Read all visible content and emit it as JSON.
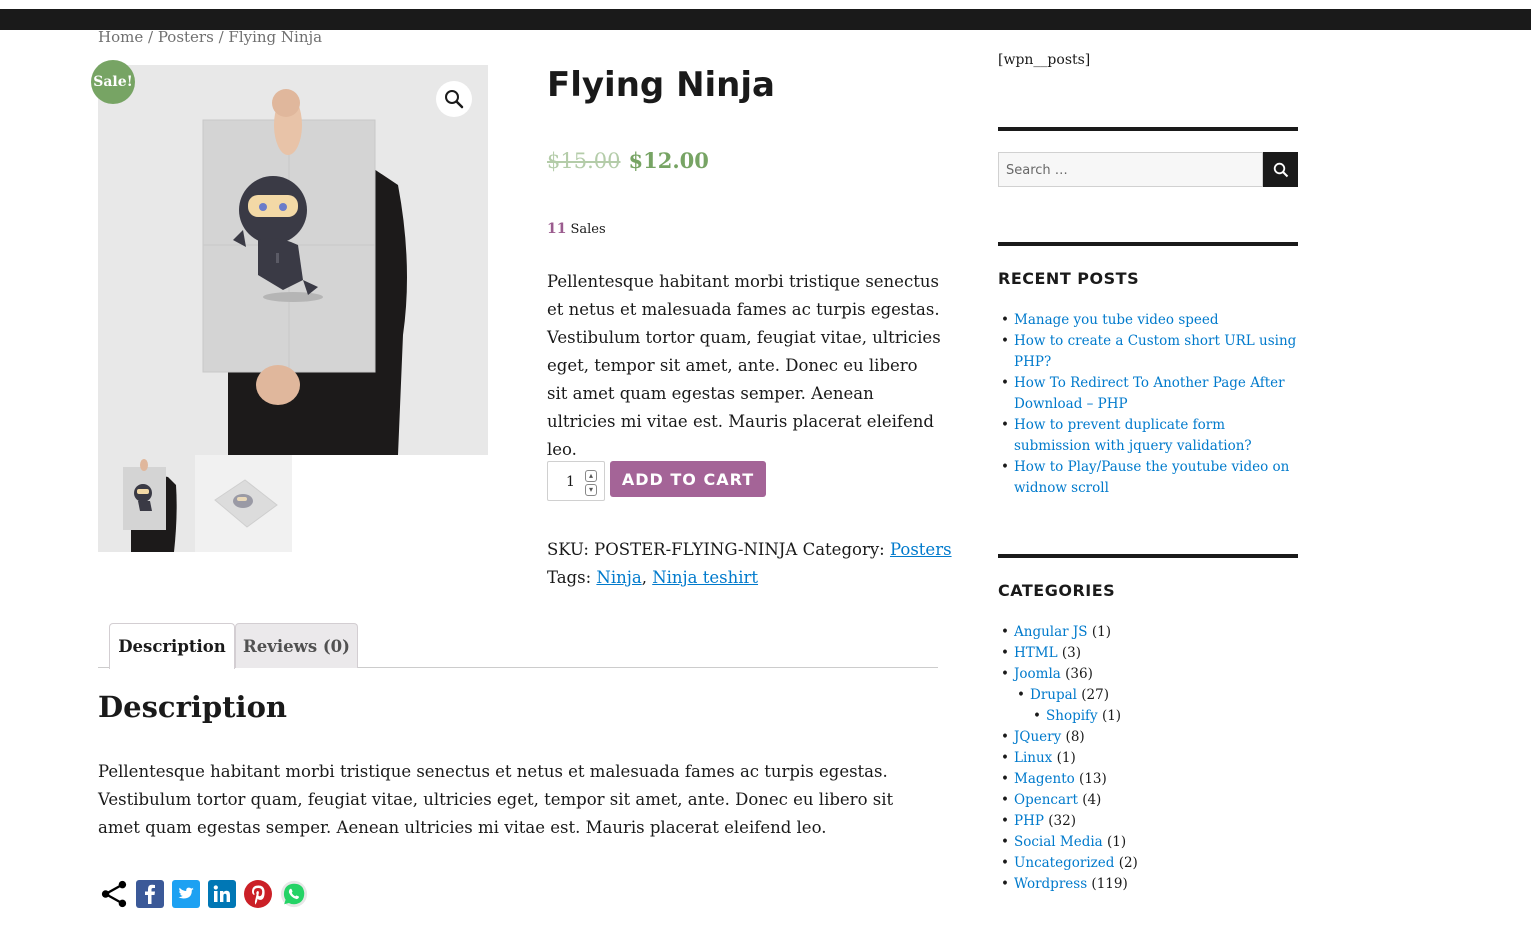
{
  "breadcrumb": {
    "home": "Home",
    "sep1": " / ",
    "category": "Posters",
    "sep2": " / ",
    "current": "Flying Ninja"
  },
  "product": {
    "sale_badge": "Sale!",
    "title": "Flying Ninja",
    "old_price": "$15.00",
    "new_price": "$12.00",
    "sales_count": "11",
    "sales_label": "Sales",
    "short_description": "Pellentesque habitant morbi tristique senectus et netus et malesuada fames ac turpis egestas. Vestibulum tortor quam, feugiat vitae, ultricies eget, tempor sit amet, ante. Donec eu libero sit amet quam egestas semper. Aenean ultricies mi vitae est. Mauris placerat eleifend leo.",
    "quantity": "1",
    "add_to_cart": "ADD TO CART",
    "sku_label": "SKU:",
    "sku": "POSTER-FLYING-NINJA",
    "category_label": "Category:",
    "category": "Posters",
    "tags_label": "Tags:",
    "tag1": "Ninja",
    "tag_sep": ",",
    "tag2": "Ninja teshirt"
  },
  "tabs": {
    "description": "Description",
    "reviews": "Reviews (0)"
  },
  "description": {
    "heading": "Description",
    "text": "Pellentesque habitant morbi tristique senectus et netus et malesuada fames ac turpis egestas. Vestibulum tortor quam, feugiat vitae, ultricies eget, tempor sit amet, ante. Donec eu libero sit amet quam egestas semper. Aenean ultricies mi vitae est. Mauris placerat eleifend leo."
  },
  "share_icons": [
    "share-icon",
    "facebook-icon",
    "twitter-icon",
    "linkedin-icon",
    "pinterest-icon",
    "whatsapp-icon"
  ],
  "sidebar": {
    "shortcode": "[wpn__posts]",
    "search_placeholder": "Search …",
    "recent_title": "RECENT POSTS",
    "recent_posts": [
      "Manage you tube video speed",
      "How to create a Custom short URL using PHP?",
      "How To Redirect To Another Page After Download – PHP",
      "How to prevent duplicate form submission with jquery validation?",
      "How to Play/Pause the youtube video on widnow scroll"
    ],
    "categories_title": "CATEGORIES",
    "categories": [
      {
        "name": "Angular JS",
        "count": "(1)"
      },
      {
        "name": "HTML",
        "count": "(3)"
      },
      {
        "name": "Joomla",
        "count": "(36)"
      },
      {
        "name": "Drupal",
        "count": "(27)"
      },
      {
        "name": "Shopify",
        "count": "(1)"
      },
      {
        "name": "JQuery",
        "count": "(8)"
      },
      {
        "name": "Linux",
        "count": "(1)"
      },
      {
        "name": "Magento",
        "count": "(13)"
      },
      {
        "name": "Opencart",
        "count": "(4)"
      },
      {
        "name": "PHP",
        "count": "(32)"
      },
      {
        "name": "Social Media",
        "count": "(1)"
      },
      {
        "name": "Uncategorized",
        "count": "(2)"
      },
      {
        "name": "Wordpress",
        "count": "(119)"
      }
    ]
  },
  "colors": {
    "accent": "#a46497",
    "sale": "#77a464",
    "link": "#007acc",
    "dark": "#1a1a1a"
  }
}
